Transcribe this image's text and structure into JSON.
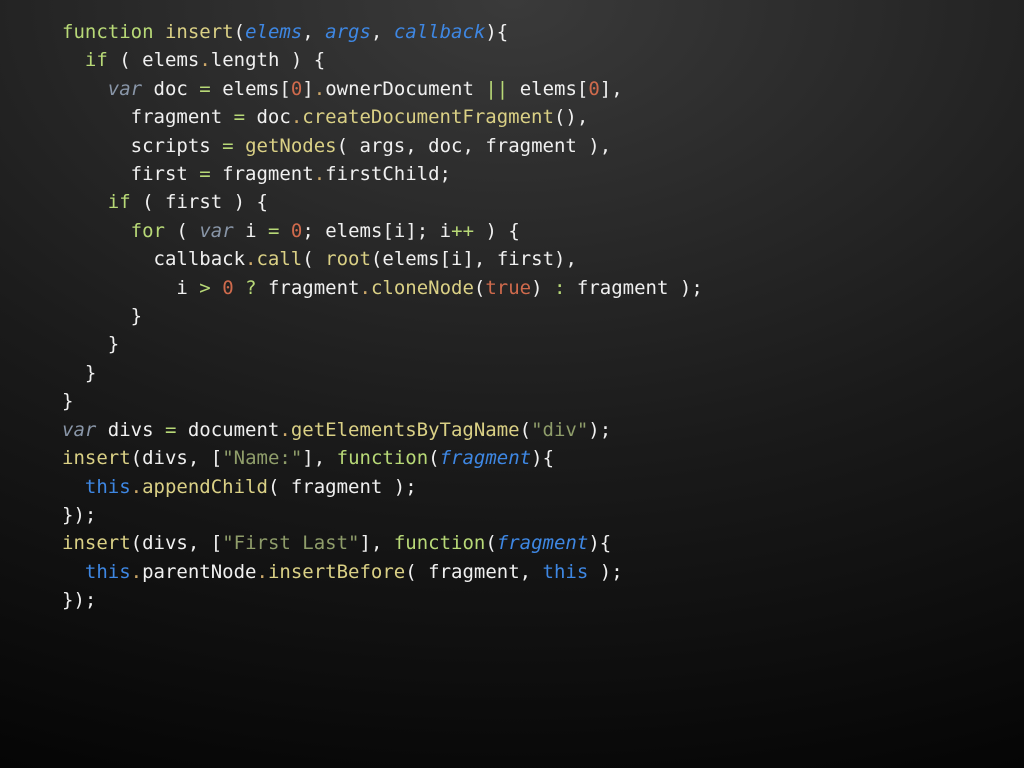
{
  "code": {
    "lines": [
      [
        [
          "kw",
          "function"
        ],
        [
          "plain",
          " "
        ],
        [
          "call",
          "insert"
        ],
        [
          "paren",
          "("
        ],
        [
          "ident it",
          "elems"
        ],
        [
          "punct",
          ", "
        ],
        [
          "ident it",
          "args"
        ],
        [
          "punct",
          ", "
        ],
        [
          "ident it",
          "callback"
        ],
        [
          "paren",
          ")"
        ],
        [
          "punct",
          "{"
        ]
      ],
      [
        [
          "plain",
          "  "
        ],
        [
          "kw",
          "if"
        ],
        [
          "plain",
          " "
        ],
        [
          "paren",
          "("
        ],
        [
          "plain",
          " elems"
        ],
        [
          "op",
          "."
        ],
        [
          "plain",
          "length "
        ],
        [
          "paren",
          ")"
        ],
        [
          "plain",
          " {"
        ]
      ],
      [
        [
          "plain",
          "    "
        ],
        [
          "type it",
          "var"
        ],
        [
          "plain",
          " doc "
        ],
        [
          "kw",
          "="
        ],
        [
          "plain",
          " elems"
        ],
        [
          "punct",
          "["
        ],
        [
          "num",
          "0"
        ],
        [
          "punct",
          "]"
        ],
        [
          "op",
          "."
        ],
        [
          "plain",
          "ownerDocument "
        ],
        [
          "kw",
          "||"
        ],
        [
          "plain",
          " elems"
        ],
        [
          "punct",
          "["
        ],
        [
          "num",
          "0"
        ],
        [
          "punct",
          "],"
        ]
      ],
      [
        [
          "plain",
          "      fragment "
        ],
        [
          "kw",
          "="
        ],
        [
          "plain",
          " doc"
        ],
        [
          "op",
          "."
        ],
        [
          "call",
          "createDocumentFragment"
        ],
        [
          "paren",
          "()"
        ],
        [
          "punct",
          ","
        ]
      ],
      [
        [
          "plain",
          "      scripts "
        ],
        [
          "kw",
          "="
        ],
        [
          "plain",
          " "
        ],
        [
          "call",
          "getNodes"
        ],
        [
          "paren",
          "("
        ],
        [
          "plain",
          " args"
        ],
        [
          "punct",
          ","
        ],
        [
          "plain",
          " doc"
        ],
        [
          "punct",
          ","
        ],
        [
          "plain",
          " fragment "
        ],
        [
          "paren",
          ")"
        ],
        [
          "punct",
          ","
        ]
      ],
      [
        [
          "plain",
          "      first "
        ],
        [
          "kw",
          "="
        ],
        [
          "plain",
          " fragment"
        ],
        [
          "op",
          "."
        ],
        [
          "plain",
          "firstChild;"
        ]
      ],
      [
        [
          "plain",
          ""
        ]
      ],
      [
        [
          "plain",
          "    "
        ],
        [
          "kw",
          "if"
        ],
        [
          "plain",
          " "
        ],
        [
          "paren",
          "("
        ],
        [
          "plain",
          " first "
        ],
        [
          "paren",
          ")"
        ],
        [
          "plain",
          " {"
        ]
      ],
      [
        [
          "plain",
          "      "
        ],
        [
          "kw",
          "for"
        ],
        [
          "plain",
          " "
        ],
        [
          "paren",
          "("
        ],
        [
          "plain",
          " "
        ],
        [
          "type it",
          "var"
        ],
        [
          "plain",
          " i "
        ],
        [
          "kw",
          "="
        ],
        [
          "plain",
          " "
        ],
        [
          "num",
          "0"
        ],
        [
          "punct",
          ";"
        ],
        [
          "plain",
          " elems"
        ],
        [
          "punct",
          "["
        ],
        [
          "plain",
          "i"
        ],
        [
          "punct",
          "];"
        ],
        [
          "plain",
          " i"
        ],
        [
          "kw",
          "++"
        ],
        [
          "plain",
          " "
        ],
        [
          "paren",
          ")"
        ],
        [
          "plain",
          " {"
        ]
      ],
      [
        [
          "plain",
          "        callback"
        ],
        [
          "op",
          "."
        ],
        [
          "call",
          "call"
        ],
        [
          "paren",
          "("
        ],
        [
          "plain",
          " "
        ],
        [
          "call",
          "root"
        ],
        [
          "paren",
          "("
        ],
        [
          "plain",
          "elems"
        ],
        [
          "punct",
          "["
        ],
        [
          "plain",
          "i"
        ],
        [
          "punct",
          "],"
        ],
        [
          "plain",
          " first"
        ],
        [
          "paren",
          ")"
        ],
        [
          "punct",
          ","
        ]
      ],
      [
        [
          "plain",
          "          i "
        ],
        [
          "kw",
          ">"
        ],
        [
          "plain",
          " "
        ],
        [
          "num",
          "0"
        ],
        [
          "plain",
          " "
        ],
        [
          "kw",
          "?"
        ],
        [
          "plain",
          " fragment"
        ],
        [
          "op",
          "."
        ],
        [
          "call",
          "cloneNode"
        ],
        [
          "paren",
          "("
        ],
        [
          "bool",
          "true"
        ],
        [
          "paren",
          ")"
        ],
        [
          "plain",
          " "
        ],
        [
          "kw",
          ":"
        ],
        [
          "plain",
          " fragment "
        ],
        [
          "paren",
          ")"
        ],
        [
          "punct",
          ";"
        ]
      ],
      [
        [
          "plain",
          "      }"
        ]
      ],
      [
        [
          "plain",
          "    }"
        ]
      ],
      [
        [
          "plain",
          "  }"
        ]
      ],
      [
        [
          "plain",
          "}"
        ]
      ],
      [
        [
          "plain",
          ""
        ]
      ],
      [
        [
          "type it",
          "var"
        ],
        [
          "plain",
          " divs "
        ],
        [
          "kw",
          "="
        ],
        [
          "plain",
          " document"
        ],
        [
          "op",
          "."
        ],
        [
          "call",
          "getElementsByTagName"
        ],
        [
          "paren",
          "("
        ],
        [
          "str",
          "\"div\""
        ],
        [
          "paren",
          ")"
        ],
        [
          "punct",
          ";"
        ]
      ],
      [
        [
          "plain",
          ""
        ]
      ],
      [
        [
          "call",
          "insert"
        ],
        [
          "paren",
          "("
        ],
        [
          "plain",
          "divs"
        ],
        [
          "punct",
          ", "
        ],
        [
          "punct",
          "["
        ],
        [
          "str",
          "\"Name:\""
        ],
        [
          "punct",
          "]"
        ],
        [
          "punct",
          ", "
        ],
        [
          "kw",
          "function"
        ],
        [
          "paren",
          "("
        ],
        [
          "ident it",
          "fragment"
        ],
        [
          "paren",
          ")"
        ],
        [
          "punct",
          "{"
        ]
      ],
      [
        [
          "plain",
          "  "
        ],
        [
          "ident",
          "this"
        ],
        [
          "op",
          "."
        ],
        [
          "call",
          "appendChild"
        ],
        [
          "paren",
          "("
        ],
        [
          "plain",
          " fragment "
        ],
        [
          "paren",
          ")"
        ],
        [
          "punct",
          ";"
        ]
      ],
      [
        [
          "punct",
          "}"
        ],
        [
          "paren",
          ")"
        ],
        [
          "punct",
          ";"
        ]
      ],
      [
        [
          "plain",
          ""
        ]
      ],
      [
        [
          "call",
          "insert"
        ],
        [
          "paren",
          "("
        ],
        [
          "plain",
          "divs"
        ],
        [
          "punct",
          ", "
        ],
        [
          "punct",
          "["
        ],
        [
          "str",
          "\"First Last\""
        ],
        [
          "punct",
          "]"
        ],
        [
          "punct",
          ", "
        ],
        [
          "kw",
          "function"
        ],
        [
          "paren",
          "("
        ],
        [
          "ident it",
          "fragment"
        ],
        [
          "paren",
          ")"
        ],
        [
          "punct",
          "{"
        ]
      ],
      [
        [
          "plain",
          "  "
        ],
        [
          "ident",
          "this"
        ],
        [
          "op",
          "."
        ],
        [
          "plain",
          "parentNode"
        ],
        [
          "op",
          "."
        ],
        [
          "call",
          "insertBefore"
        ],
        [
          "paren",
          "("
        ],
        [
          "plain",
          " fragment"
        ],
        [
          "punct",
          ","
        ],
        [
          "plain",
          " "
        ],
        [
          "ident",
          "this"
        ],
        [
          "plain",
          " "
        ],
        [
          "paren",
          ")"
        ],
        [
          "punct",
          ";"
        ]
      ],
      [
        [
          "punct",
          "}"
        ],
        [
          "paren",
          ")"
        ],
        [
          "punct",
          ";"
        ]
      ]
    ]
  }
}
